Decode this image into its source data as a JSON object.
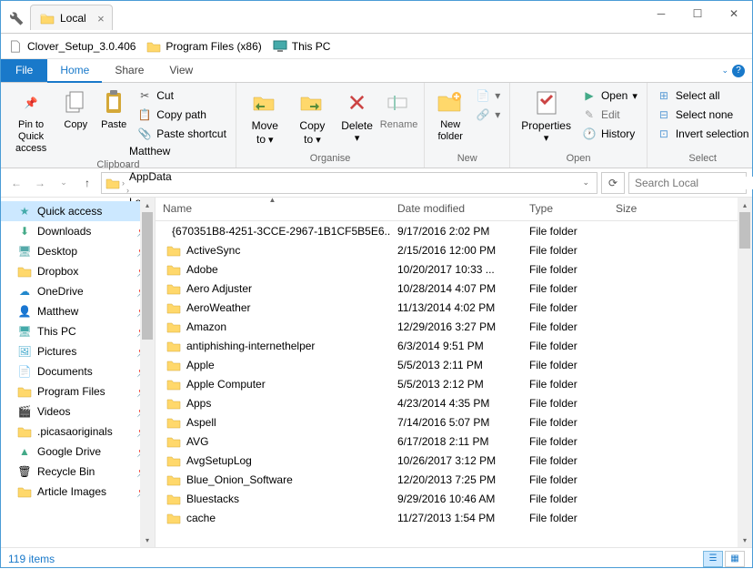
{
  "tab_title": "Local",
  "bookmarks": [
    {
      "icon": "file",
      "label": "Clover_Setup_3.0.406"
    },
    {
      "icon": "folder",
      "label": "Program Files (x86)"
    },
    {
      "icon": "monitor",
      "label": "This PC"
    }
  ],
  "ribbon_tabs": {
    "file": "File",
    "home": "Home",
    "share": "Share",
    "view": "View"
  },
  "ribbon": {
    "clipboard": {
      "label": "Clipboard",
      "pin": "Pin to Quick access",
      "copy": "Copy",
      "paste": "Paste",
      "cut": "Cut",
      "copy_path": "Copy path",
      "paste_shortcut": "Paste shortcut"
    },
    "organise": {
      "label": "Organise",
      "move": "Move to",
      "copy": "Copy to",
      "delete": "Delete",
      "rename": "Rename"
    },
    "new": {
      "label": "New",
      "folder": "New folder"
    },
    "open": {
      "label": "Open",
      "properties": "Properties",
      "open": "Open",
      "edit": "Edit",
      "history": "History"
    },
    "select": {
      "label": "Select",
      "all": "Select all",
      "none": "Select none",
      "invert": "Invert selection"
    }
  },
  "breadcrumbs": [
    "Matthew",
    "AppData",
    "Local"
  ],
  "search_placeholder": "Search Local",
  "columns": {
    "name": "Name",
    "date": "Date modified",
    "type": "Type",
    "size": "Size"
  },
  "nav_items": [
    {
      "icon": "star",
      "label": "Quick access",
      "pin": false,
      "sel": true
    },
    {
      "icon": "download",
      "label": "Downloads",
      "pin": true
    },
    {
      "icon": "desktop",
      "label": "Desktop",
      "pin": true
    },
    {
      "icon": "folder",
      "label": "Dropbox",
      "pin": true
    },
    {
      "icon": "onedrive",
      "label": "OneDrive",
      "pin": true
    },
    {
      "icon": "user",
      "label": "Matthew",
      "pin": true
    },
    {
      "icon": "monitor",
      "label": "This PC",
      "pin": true
    },
    {
      "icon": "pictures",
      "label": "Pictures",
      "pin": true
    },
    {
      "icon": "documents",
      "label": "Documents",
      "pin": true
    },
    {
      "icon": "folder",
      "label": "Program Files",
      "pin": true
    },
    {
      "icon": "videos",
      "label": "Videos",
      "pin": true
    },
    {
      "icon": "folder",
      "label": ".picasaoriginals",
      "pin": true
    },
    {
      "icon": "gdrive",
      "label": "Google Drive",
      "pin": true
    },
    {
      "icon": "recycle",
      "label": "Recycle Bin",
      "pin": true
    },
    {
      "icon": "folder",
      "label": "Article Images",
      "pin": true
    }
  ],
  "files": [
    {
      "name": "{670351B8-4251-3CCE-2967-1B1CF5B5E6...",
      "date": "9/17/2016 2:02 PM",
      "type": "File folder"
    },
    {
      "name": "ActiveSync",
      "date": "2/15/2016 12:00 PM",
      "type": "File folder"
    },
    {
      "name": "Adobe",
      "date": "10/20/2017 10:33 ...",
      "type": "File folder"
    },
    {
      "name": "Aero Adjuster",
      "date": "10/28/2014 4:07 PM",
      "type": "File folder"
    },
    {
      "name": "AeroWeather",
      "date": "11/13/2014 4:02 PM",
      "type": "File folder"
    },
    {
      "name": "Amazon",
      "date": "12/29/2016 3:27 PM",
      "type": "File folder"
    },
    {
      "name": "antiphishing-internethelper",
      "date": "6/3/2014 9:51 PM",
      "type": "File folder"
    },
    {
      "name": "Apple",
      "date": "5/5/2013 2:11 PM",
      "type": "File folder"
    },
    {
      "name": "Apple Computer",
      "date": "5/5/2013 2:12 PM",
      "type": "File folder"
    },
    {
      "name": "Apps",
      "date": "4/23/2014 4:35 PM",
      "type": "File folder"
    },
    {
      "name": "Aspell",
      "date": "7/14/2016 5:07 PM",
      "type": "File folder"
    },
    {
      "name": "AVG",
      "date": "6/17/2018 2:11 PM",
      "type": "File folder"
    },
    {
      "name": "AvgSetupLog",
      "date": "10/26/2017 3:12 PM",
      "type": "File folder"
    },
    {
      "name": "Blue_Onion_Software",
      "date": "12/20/2013 7:25 PM",
      "type": "File folder"
    },
    {
      "name": "Bluestacks",
      "date": "9/29/2016 10:46 AM",
      "type": "File folder"
    },
    {
      "name": "cache",
      "date": "11/27/2013 1:54 PM",
      "type": "File folder"
    }
  ],
  "status": "119 items"
}
